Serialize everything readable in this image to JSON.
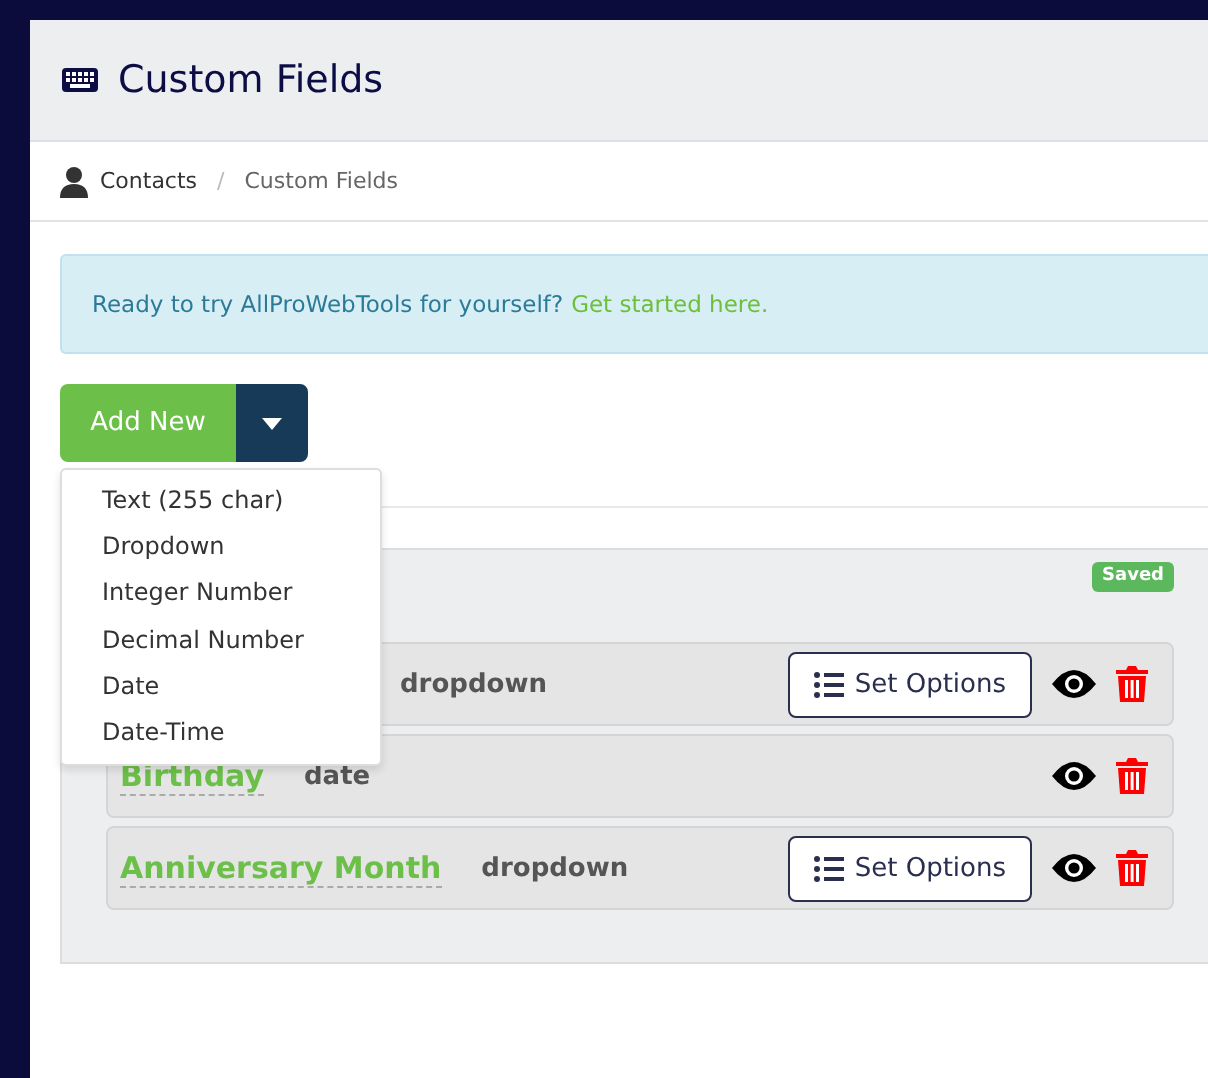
{
  "page_title": "Custom Fields",
  "breadcrumb_separator": "/",
  "breadcrumb": [
    {
      "label": "Contacts",
      "kind": "link"
    },
    {
      "label": "Custom Fields",
      "kind": "current"
    }
  ],
  "alert": {
    "text": "Ready to try AllProWebTools for yourself?",
    "link": "Get started here."
  },
  "add_button": "Add New",
  "menu": {
    "expanded": true,
    "items": [
      "Text (255 char)",
      "Dropdown",
      "Integer Number",
      "Decimal Number",
      "Date",
      "Date-Time"
    ]
  },
  "status_badge": "Saved",
  "fields": [
    {
      "type": "dropdown",
      "has_options": true,
      "options_button": "Set Options"
    },
    {
      "name": "Birthday",
      "type": "date",
      "has_options": false
    },
    {
      "name": "Anniversary Month",
      "type": "dropdown",
      "has_options": true,
      "options_button": "Set Options"
    }
  ]
}
